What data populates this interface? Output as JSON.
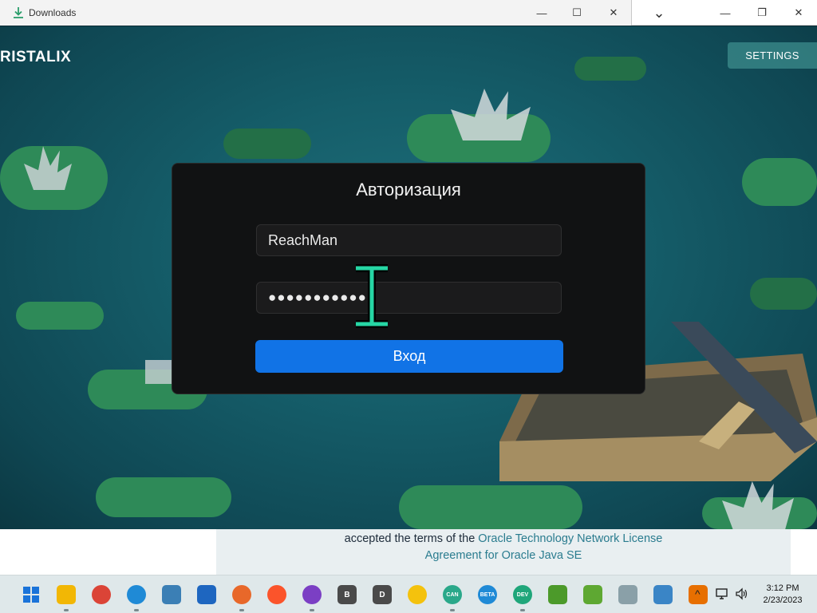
{
  "window": {
    "title": "Downloads",
    "controls": {
      "minimize": "—",
      "maximize": "☐",
      "close": "✕"
    },
    "outer_controls": {
      "dropdown": "⌄",
      "minimize": "—",
      "restore": "❐",
      "close": "✕"
    }
  },
  "game": {
    "logo": "RISTALIX",
    "settings_label": "SETTINGS"
  },
  "login": {
    "title": "Авторизация",
    "username": "ReachMan",
    "password_mask": "●●●●●●●●●●●",
    "submit_label": "Вход"
  },
  "page": {
    "license_prefix": "accepted the terms of the ",
    "license_link_1": "Oracle Technology Network License",
    "license_link_2": "Agreement for Oracle Java SE"
  },
  "taskbar": {
    "apps": [
      {
        "name": "start",
        "color": "#1a73d9"
      },
      {
        "name": "file-explorer",
        "color": "#f2b705"
      },
      {
        "name": "chrome",
        "color": "#db4437"
      },
      {
        "name": "edge",
        "color": "#1f8ad6"
      },
      {
        "name": "photos",
        "color": "#3b7fb5"
      },
      {
        "name": "app-window",
        "color": "#1e66c0"
      },
      {
        "name": "firefox",
        "color": "#e8682a"
      },
      {
        "name": "brave",
        "color": "#fb542b"
      },
      {
        "name": "app-purple",
        "color": "#7b3fc4"
      },
      {
        "name": "chrome-beta",
        "color": "#4a4a4a",
        "badge": "B"
      },
      {
        "name": "chrome-dev",
        "color": "#4a4a4a",
        "badge": "D"
      },
      {
        "name": "chrome-canary",
        "color": "#f4c20d"
      },
      {
        "name": "edge-canary",
        "color": "#2aa88a",
        "badge": "CAN"
      },
      {
        "name": "edge-beta",
        "color": "#1f8ad6",
        "badge": "BETA"
      },
      {
        "name": "edge-dev",
        "color": "#1fa67a",
        "badge": "DEV"
      },
      {
        "name": "app-green-1",
        "color": "#4c9a2a"
      },
      {
        "name": "app-green-2",
        "color": "#5ea832"
      },
      {
        "name": "disc-app",
        "color": "#8aa0a8"
      },
      {
        "name": "window-app",
        "color": "#3a85c6"
      },
      {
        "name": "java",
        "color": "#e76f00"
      }
    ],
    "tray": {
      "chevron": "^",
      "time": "3:12 PM",
      "date": "2/23/2023"
    }
  }
}
